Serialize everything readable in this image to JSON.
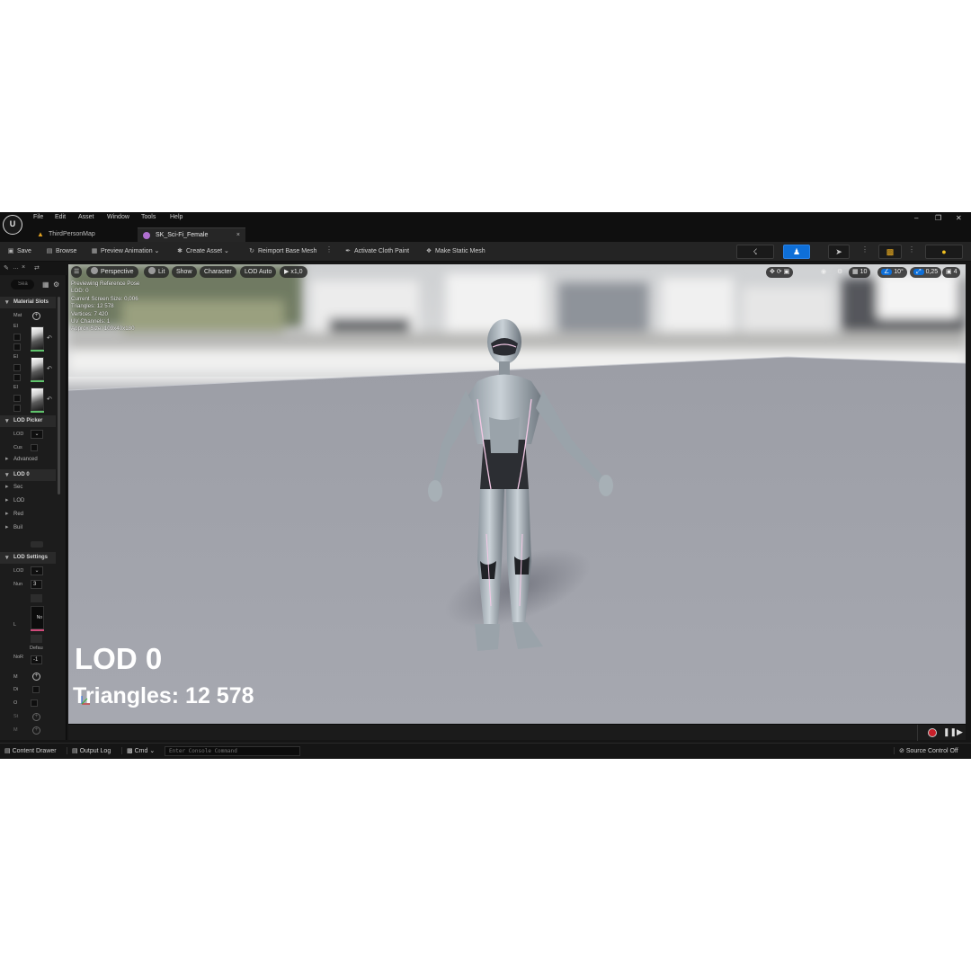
{
  "menu": [
    "File",
    "Edit",
    "Asset",
    "Window",
    "Tools",
    "Help"
  ],
  "logo": "U",
  "window_controls": [
    "–",
    "❐",
    "✕"
  ],
  "tabs": {
    "level": "ThirdPersonMap",
    "asset": "SK_Sci-Fi_Female",
    "close": "×"
  },
  "toolbar": {
    "save": "Save",
    "browse": "Browse",
    "preview_animation": "Preview Animation",
    "create_asset": "Create Asset",
    "reimport": "Reimport Base Mesh",
    "cloth_paint": "Activate Cloth Paint",
    "static_mesh": "Make Static Mesh"
  },
  "left_panel": {
    "search_placeholder": "Sea",
    "tab1": "…",
    "sections": {
      "material_slots": "Material Slots",
      "lod_picker": "LOD Picker",
      "lod0": "LOD 0",
      "lod_settings": "LOD Settings"
    },
    "labels": {
      "mat": "Mat",
      "el": "El",
      "lod": "LOD",
      "cus": "Cus",
      "advanced": "Advanced",
      "sec": "Sec",
      "lod_row": "LOD",
      "red": "Red",
      "buil": "Buil",
      "lod_s": "LOD",
      "nun": "Nun",
      "nun_val": "3",
      "l": "L",
      "no": "No",
      "defau": "Defau",
      "nor": "NoR",
      "neg1": "-1",
      "m1": "M",
      "di": "Di",
      "o": "O",
      "st": "St",
      "m2": "M"
    }
  },
  "viewport": {
    "perspective": "Perspective",
    "lit": "Lit",
    "show": "Show",
    "character": "Character",
    "lod_auto": "LOD Auto",
    "speed": "x1,0",
    "grid": "10",
    "angle": "10°",
    "scale": "0,25",
    "camera": "4",
    "stats": [
      "Previewing Reference Pose",
      "LOD: 0",
      "Current Screen Size: 0,006",
      "Triangles: 12 578",
      "Vertices: 7 420",
      "UV Channels: 1",
      "Approx Size: 109x40x180"
    ],
    "overlay_lod": "LOD 0",
    "overlay_triangles": "Triangles: 12 578"
  },
  "statusbar": {
    "content_drawer": "Content Drawer",
    "output_log": "Output Log",
    "cmd": "Cmd",
    "console_placeholder": "Enter Console Command",
    "source_control": "Source Control Off"
  },
  "colors": {
    "accent": "#0e6fd8",
    "record": "#c8202a",
    "panel": "#1c1c1c"
  }
}
